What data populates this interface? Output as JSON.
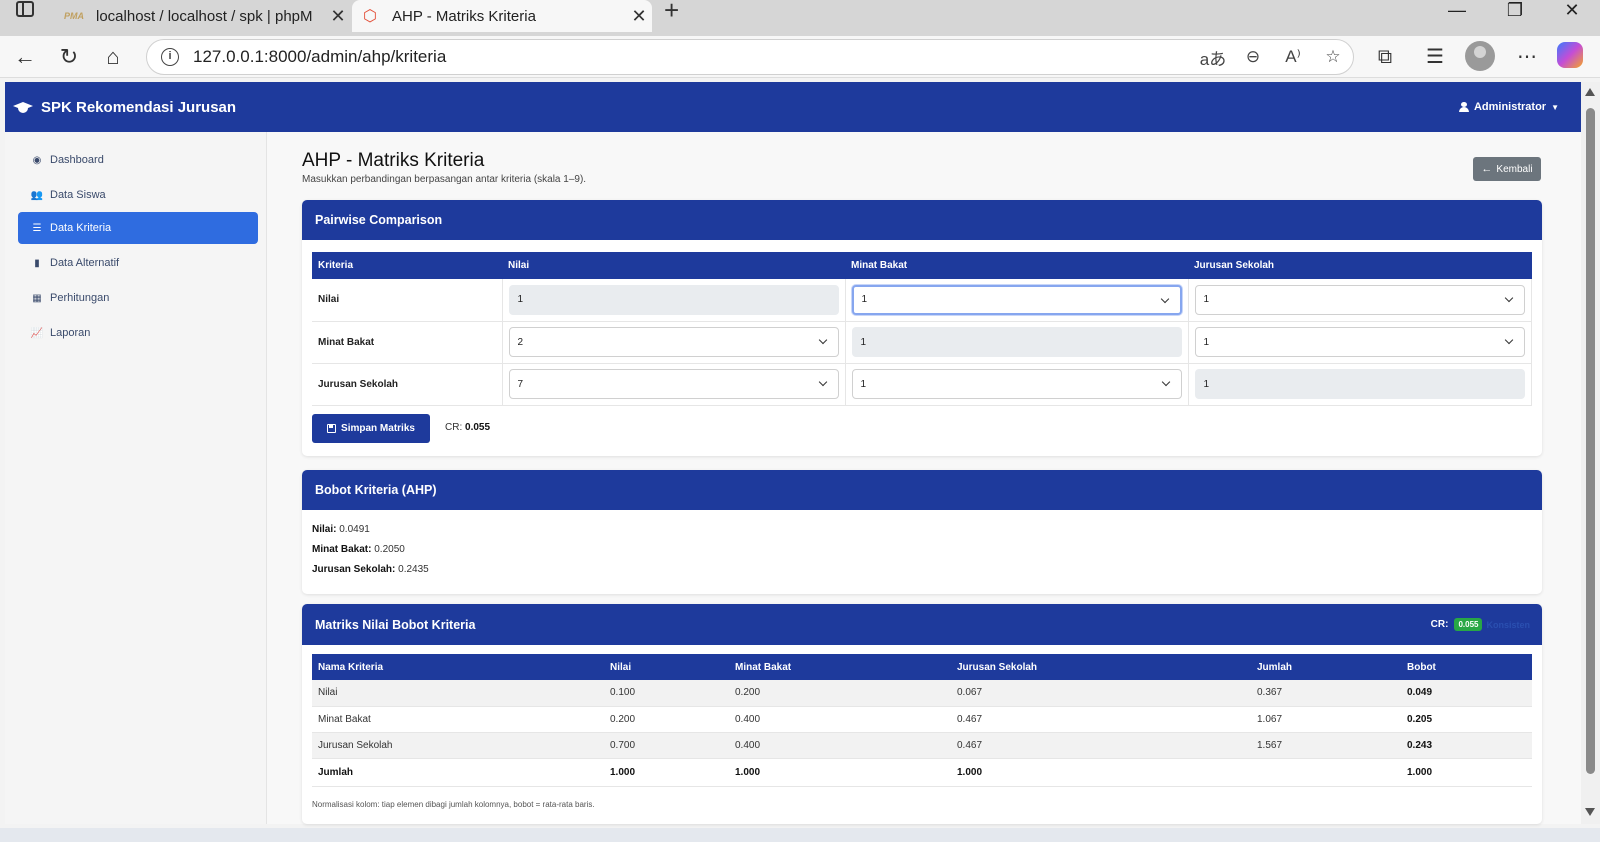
{
  "browser": {
    "tabs": [
      {
        "title": "localhost / localhost / spk | phpM",
        "favicon": "phpmyadmin-icon"
      },
      {
        "title": "AHP - Matriks Kriteria",
        "favicon": "laravel-icon"
      }
    ],
    "url": "127.0.0.1:8000/admin/ahp/kriteria"
  },
  "navbar": {
    "brand": "SPK Rekomendasi Jurusan",
    "user": "Administrator"
  },
  "sidebar": {
    "items": [
      {
        "label": "Dashboard",
        "icon": "gauge-icon"
      },
      {
        "label": "Data Siswa",
        "icon": "users-icon"
      },
      {
        "label": "Data Kriteria",
        "icon": "list-icon",
        "active": true
      },
      {
        "label": "Data Alternatif",
        "icon": "bookmark-icon"
      },
      {
        "label": "Perhitungan",
        "icon": "calculator-icon"
      },
      {
        "label": "Laporan",
        "icon": "chart-icon"
      }
    ]
  },
  "page": {
    "title": "AHP - Matriks Kriteria",
    "subtitle": "Masukkan perbandingan berpasangan antar kriteria (skala 1–9).",
    "back_label": "Kembali"
  },
  "pairwise": {
    "header": "Pairwise Comparison",
    "columns": [
      "Kriteria",
      "Nilai",
      "Minat Bakat",
      "Jurusan Sekolah"
    ],
    "rows": [
      {
        "label": "Nilai",
        "cells": [
          "1",
          "1",
          "1"
        ]
      },
      {
        "label": "Minat Bakat",
        "cells": [
          "2",
          "1",
          "1"
        ]
      },
      {
        "label": "Jurusan Sekolah",
        "cells": [
          "7",
          "1",
          "1"
        ]
      }
    ],
    "save_label": "Simpan Matriks",
    "cr_label": "CR:",
    "cr_value": "0.055"
  },
  "weights": {
    "header": "Bobot Kriteria (AHP)",
    "items": [
      {
        "label": "Nilai:",
        "value": "0.0491"
      },
      {
        "label": "Minat Bakat:",
        "value": "0.2050"
      },
      {
        "label": "Jurusan Sekolah:",
        "value": "0.2435"
      }
    ]
  },
  "matrix": {
    "header": "Matriks Nilai Bobot Kriteria",
    "cr_label": "CR:",
    "cr_badge": "0.055",
    "cr_status": "Konsisten",
    "columns": [
      "Nama Kriteria",
      "Nilai",
      "Minat Bakat",
      "Jurusan Sekolah",
      "Jumlah",
      "Bobot"
    ],
    "rows": [
      [
        "Nilai",
        "0.100",
        "0.200",
        "0.067",
        "0.367",
        "0.049"
      ],
      [
        "Minat Bakat",
        "0.200",
        "0.400",
        "0.467",
        "1.067",
        "0.205"
      ],
      [
        "Jurusan Sekolah",
        "0.700",
        "0.400",
        "0.467",
        "1.567",
        "0.243"
      ]
    ],
    "total": [
      "Jumlah",
      "1.000",
      "1.000",
      "1.000",
      "",
      "1.000"
    ],
    "note": "Normalisasi kolom: tiap elemen dibagi jumlah kolomnya, bobot = rata-rata baris."
  }
}
